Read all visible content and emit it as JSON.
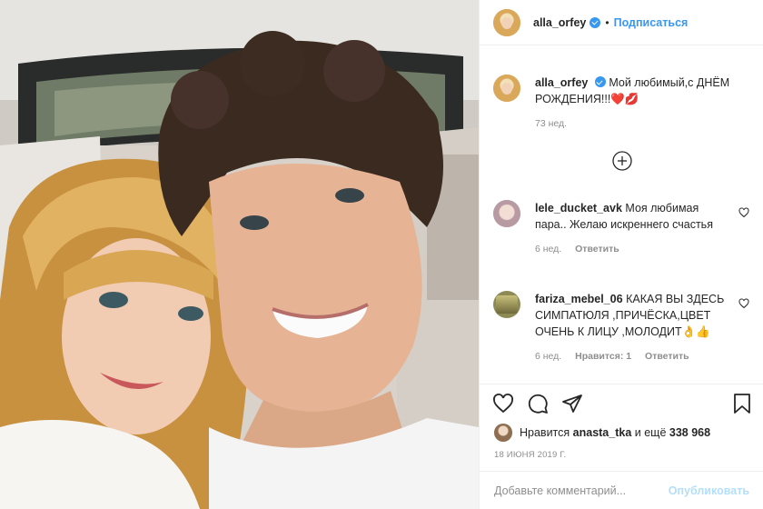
{
  "post": {
    "image_alt": "Селфи пары в машине"
  },
  "header": {
    "username": "alla_orfey",
    "separator": "•",
    "follow_label": "Подписаться"
  },
  "caption": {
    "username": "alla_orfey",
    "text": "Мой любимый,с ДНЁМ РОЖДЕНИЯ!!!❤️💋",
    "time": "73 нед."
  },
  "comments": [
    {
      "username": "lele_ducket_avk",
      "text": "Моя любимая пара.. Желаю искреннего счастья",
      "time": "6 нед.",
      "likes": "",
      "reply_label": "Ответить"
    },
    {
      "username": "fariza_mebel_06",
      "text": "КАКАЯ ВЫ ЗДЕСЬ СИМПАТЮЛЯ ,ПРИЧЁСКА,ЦВЕТ ОЧЕНЬ К ЛИЦУ ,МОЛОДИТ👌👍",
      "time": "6 нед.",
      "likes": "Нравится: 1",
      "reply_label": "Ответить"
    }
  ],
  "actions": {
    "liked_by_prefix": "Нравится",
    "liked_by_user": "anasta_tka",
    "liked_by_suffix": "и ещё",
    "likes_count": "338 968",
    "date": "18 ИЮНЯ 2019 Г."
  },
  "comment_box": {
    "placeholder": "Добавьте комментарий...",
    "publish_label": "Опубликовать"
  },
  "colors": {
    "link": "#3897f0",
    "publish_disabled": "#b2dffc",
    "muted": "#8e8e8e",
    "heart": "#ed4956"
  }
}
